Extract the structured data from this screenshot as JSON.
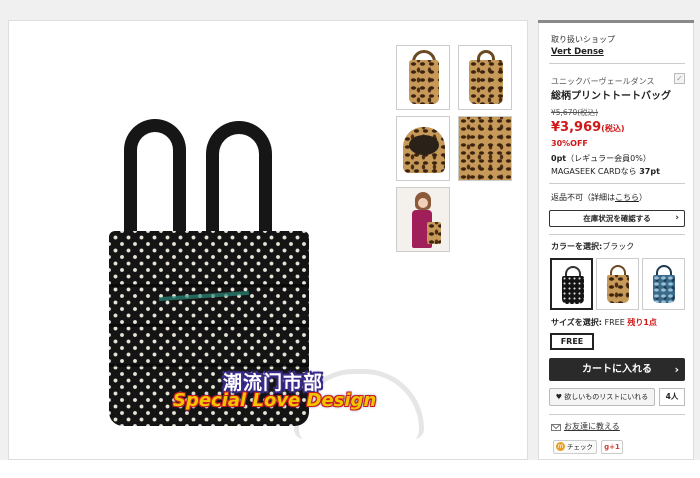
{
  "watermark": {
    "line1": "潮流门市部",
    "line2": "Special Love Design"
  },
  "thumbnails": [
    {
      "name": "leopard-bag-side"
    },
    {
      "name": "leopard-bag-front"
    },
    {
      "name": "leopard-bag-open"
    },
    {
      "name": "leopard-fabric-closeup"
    },
    {
      "name": "model-with-bag"
    }
  ],
  "sidebar": {
    "shop_label": "取り扱いショップ",
    "shop_name": "Vert Dense",
    "brand": "ユニックバーヴェールダンス",
    "check_icon": "✓",
    "product_name": "総柄プリントトートバッグ",
    "original_price": "¥5,670(税込)",
    "price": "¥3,969",
    "price_tax": "(税込)",
    "discount": "30%OFF",
    "points_value": "0pt",
    "points_note": "（レギュラー会員0%）",
    "magaseek_prefix": "MAGASEEK CARDなら",
    "magaseek_points": "37pt",
    "return_text": "返品不可（詳細は",
    "return_link": "こちら",
    "return_suffix": "）",
    "stock_button": "在庫状況を確認する",
    "color_label": "カラーを選択:",
    "color_value": "ブラック",
    "size_label": "サイズを選択:",
    "size_value": "FREE",
    "size_stock": "残り1点",
    "size_option": "FREE",
    "cart_button": "カートに入れる",
    "wishlist_button": "♥ 欲しいものリストにいれる",
    "wishlist_count": "4人",
    "friend_link": "お友達に教える",
    "mixi_label": "チェック",
    "gplus_label": "g+1"
  },
  "colors": {
    "price_red": "#d01818",
    "cart_bg": "#2a2a2a",
    "panel_bg": "#ffffff",
    "page_bg": "#f0f0f0"
  }
}
